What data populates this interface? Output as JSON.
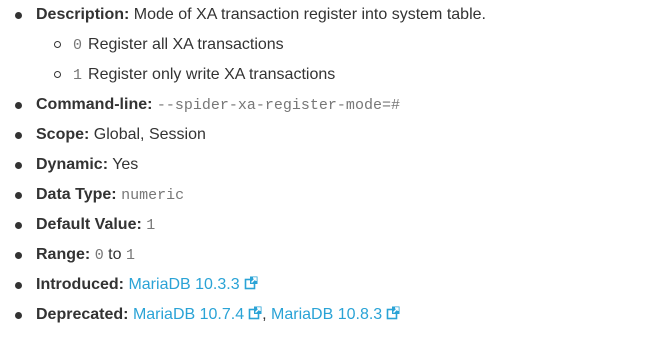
{
  "items": [
    {
      "label": "Description:",
      "text": "Mode of XA transaction register into system table.",
      "sub": [
        {
          "code": "0",
          "text": "Register all XA transactions"
        },
        {
          "code": "1",
          "text": "Register only write XA transactions"
        }
      ]
    },
    {
      "label": "Command-line:",
      "code": "--spider-xa-register-mode=#"
    },
    {
      "label": "Scope:",
      "text": "Global, Session"
    },
    {
      "label": "Dynamic:",
      "text": "Yes"
    },
    {
      "label": "Data Type:",
      "code": "numeric"
    },
    {
      "label": "Default Value:",
      "code": "1"
    },
    {
      "label": "Range:",
      "code1": "0",
      "mid": "to",
      "code2": "1"
    },
    {
      "label": "Introduced:",
      "link1": "MariaDB 10.3.3"
    },
    {
      "label": "Deprecated:",
      "link1": "MariaDB 10.7.4",
      "sep": ",",
      "link2": "MariaDB 10.8.3"
    }
  ],
  "icons": {
    "external_link": "external-link-icon"
  },
  "colors": {
    "text": "#333333",
    "code": "#777777",
    "link": "#2aa3d6"
  }
}
